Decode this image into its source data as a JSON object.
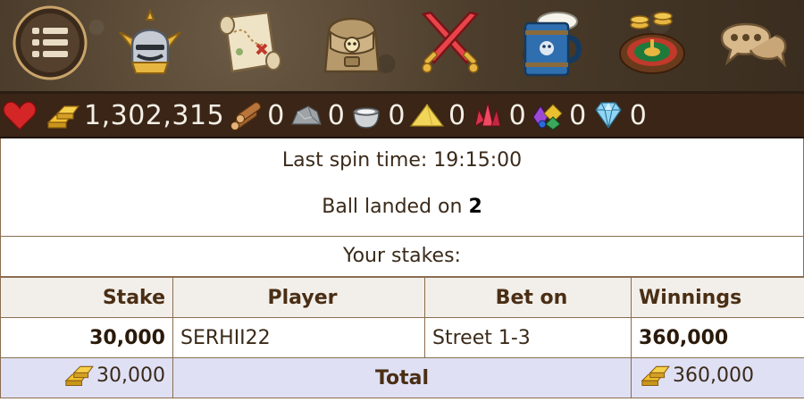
{
  "nav": {
    "items": [
      {
        "name": "menu",
        "icon": "menu-icon"
      },
      {
        "name": "knight",
        "icon": "knight-helmet-icon"
      },
      {
        "name": "map",
        "icon": "treasure-map-icon"
      },
      {
        "name": "backpack",
        "icon": "backpack-icon"
      },
      {
        "name": "battle",
        "icon": "crossed-swords-icon"
      },
      {
        "name": "tavern",
        "icon": "beer-mug-icon"
      },
      {
        "name": "roulette",
        "icon": "roulette-icon"
      },
      {
        "name": "chat",
        "icon": "chat-bubble-icon"
      }
    ]
  },
  "resources": {
    "gold": "1,302,315",
    "wood": "0",
    "stone": "0",
    "iron": "0",
    "sand": "0",
    "crystal": "0",
    "gems": "0",
    "diamond": "0"
  },
  "spin": {
    "last_spin_prefix": "Last spin time: ",
    "last_spin_time": "19:15:00",
    "ball_prefix": "Ball landed on ",
    "ball_number": "2"
  },
  "stakes": {
    "header": "Your stakes:",
    "columns": [
      "Stake",
      "Player",
      "Bet on",
      "Winnings"
    ],
    "rows": [
      {
        "stake": "30,000",
        "player": "SERHII22",
        "bet_on": "Street 1-3",
        "winnings": "360,000"
      }
    ],
    "total": {
      "stake": "30,000",
      "label": "Total",
      "winnings": "360,000"
    }
  },
  "colors": {
    "topbar": "#4a3b2a",
    "resbar": "#3a2516",
    "border": "#8a6d4f",
    "total_row": "#dfe0f4",
    "header_row": "#f2efea"
  }
}
